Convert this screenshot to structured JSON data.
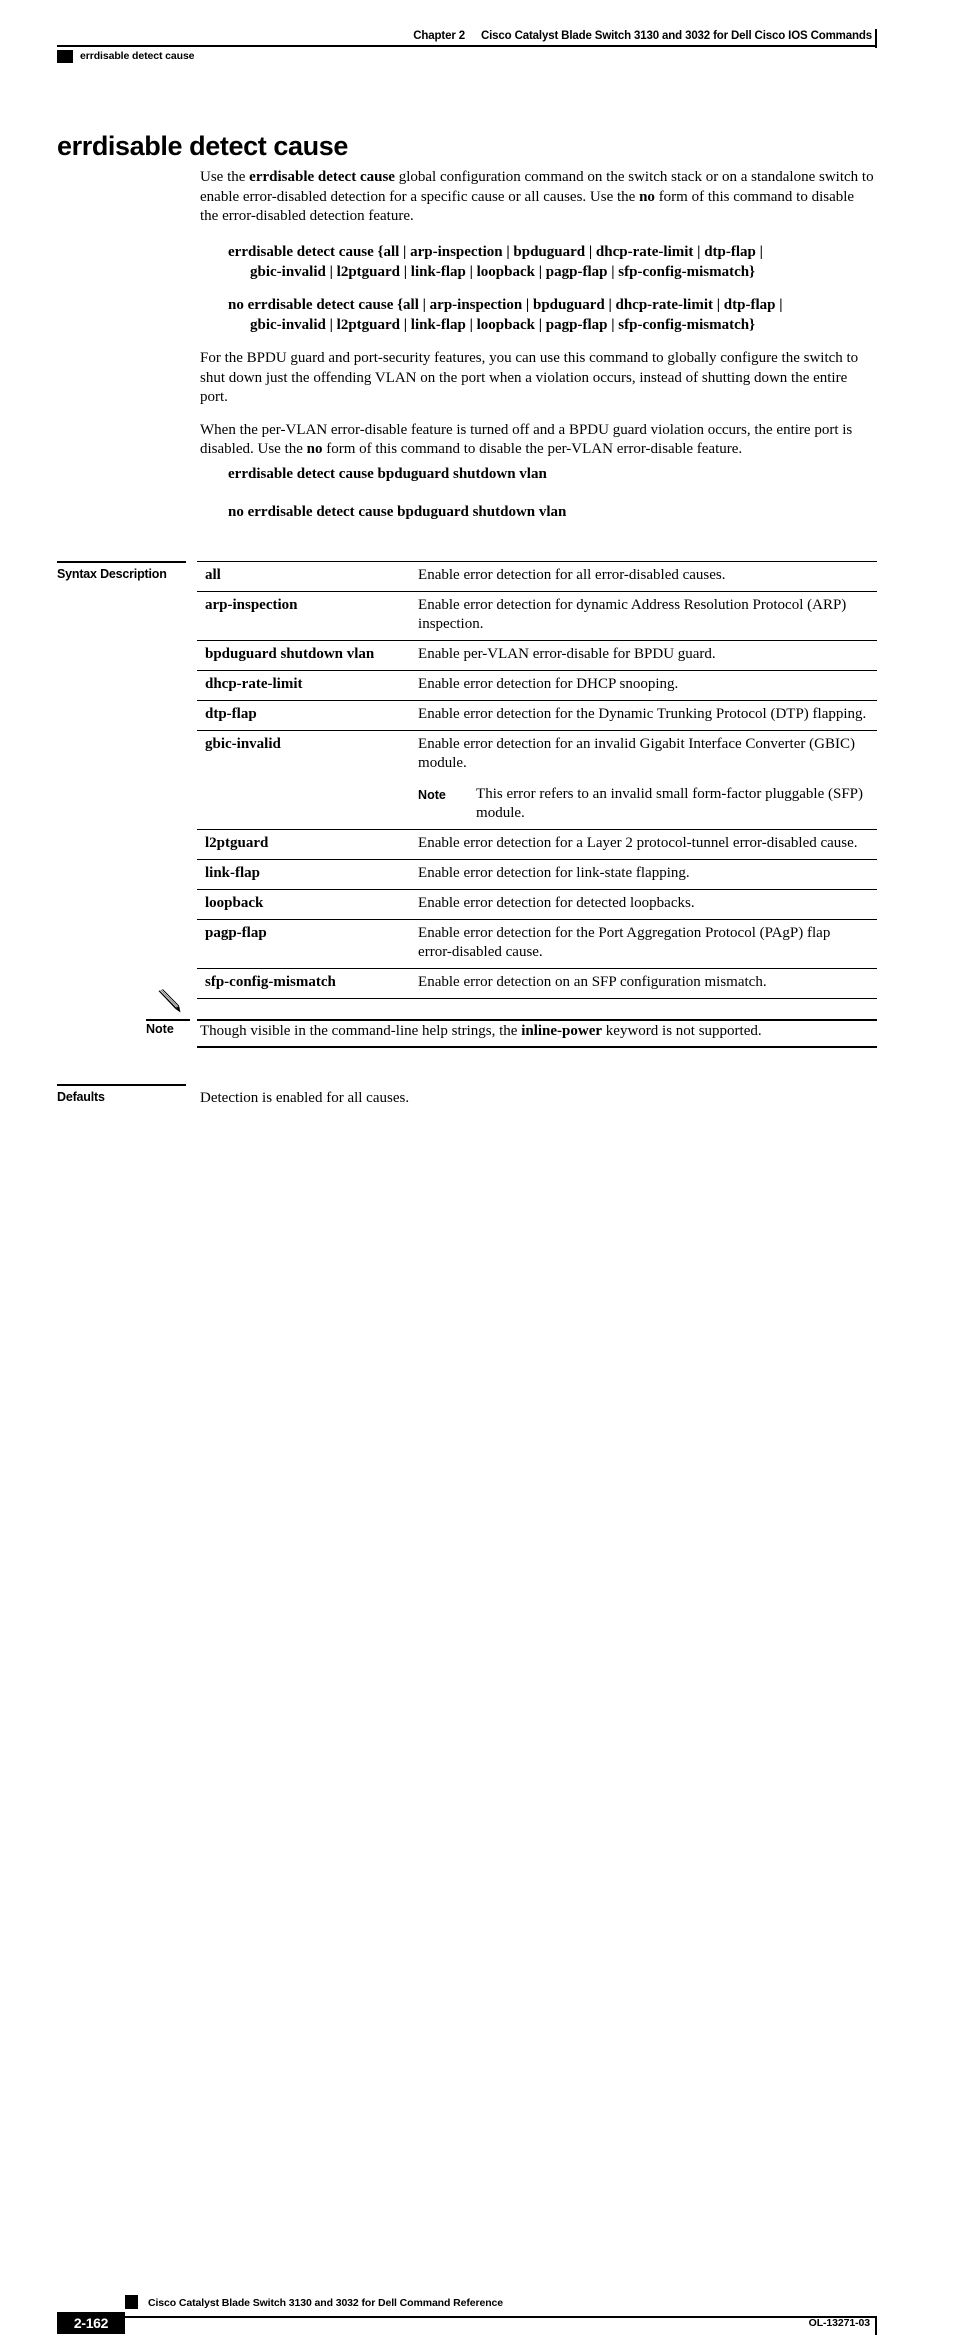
{
  "header": {
    "chapter": "Chapter 2",
    "book_title": "Cisco Catalyst Blade Switch 3130 and 3032 for Dell Cisco IOS Commands",
    "running_head": "errdisable detect cause"
  },
  "page_title": "errdisable detect cause",
  "intro": {
    "p1_a": "Use the ",
    "p1_b1": "errdisable detect cause",
    "p1_c": " global configuration command on the switch stack or on a standalone switch to enable error-disabled detection for a specific cause or all causes. Use the ",
    "p1_b2": "no",
    "p1_d": " form of this command to disable the error-disabled detection feature."
  },
  "syntax": {
    "line1_main": "errdisable detect cause {all | arp-inspection | bpduguard | dhcp-rate-limit | dtp-flap |",
    "line1_cont": "gbic-invalid | l2ptguard | link-flap | loopback | pagp-flap | sfp-config-mismatch}",
    "line2_main": "no errdisable detect cause {all | arp-inspection | bpduguard | dhcp-rate-limit | dtp-flap |",
    "line2_cont": "gbic-invalid | l2ptguard | link-flap | loopback | pagp-flap | sfp-config-mismatch}"
  },
  "body": {
    "p2": "For the BPDU guard and port-security features, you can use this command to globally configure the switch to shut down just the offending VLAN on the port when a violation occurs, instead of shutting down the entire port.",
    "p3_a": "When the per-VLAN error-disable feature is turned off and a BPDU guard violation occurs, the entire port is disabled. Use the ",
    "p3_b": "no",
    "p3_c": " form of this command to disable the per-VLAN error-disable feature.",
    "cmd1": "errdisable detect cause bpduguard shutdown vlan",
    "cmd2": "no errdisable detect cause bpduguard shutdown vlan"
  },
  "sections": {
    "syntax_description_label": "Syntax Description",
    "defaults_label": "Defaults",
    "defaults_text": "Detection is enabled for all causes."
  },
  "syntax_table": {
    "rows": [
      {
        "term": "all",
        "desc": "Enable error detection for all error-disabled causes."
      },
      {
        "term": "arp-inspection",
        "desc": "Enable error detection for dynamic Address Resolution Protocol (ARP) inspection."
      },
      {
        "term": "bpduguard shutdown vlan",
        "desc": "Enable per-VLAN error-disable for BPDU guard."
      },
      {
        "term": "dhcp-rate-limit",
        "desc": "Enable error detection for DHCP snooping."
      },
      {
        "term": "dtp-flap",
        "desc": "Enable error detection for the Dynamic Trunking Protocol (DTP) flapping."
      },
      {
        "term": "gbic-invalid",
        "desc": "Enable error detection for an invalid Gigabit Interface Converter (GBIC) module.",
        "note_label": "Note",
        "note_text": "This error refers to an invalid small form-factor pluggable (SFP) module."
      },
      {
        "term": "l2ptguard",
        "desc": "Enable error detection for a Layer 2 protocol-tunnel error-disabled cause."
      },
      {
        "term": "link-flap",
        "desc": "Enable error detection for link-state flapping."
      },
      {
        "term": "loopback",
        "desc": "Enable error detection for detected loopbacks."
      },
      {
        "term": "pagp-flap",
        "desc": "Enable error detection for the Port Aggregation Protocol (PAgP) flap error-disabled cause."
      },
      {
        "term": "sfp-config-mismatch",
        "desc": "Enable error detection on an SFP configuration mismatch."
      }
    ]
  },
  "note_callout": {
    "label": "Note",
    "text_a": "Though visible in the command-line help strings, the ",
    "text_b": "inline-power",
    "text_c": " keyword is not supported."
  },
  "footer": {
    "book_title": "Cisco Catalyst Blade Switch 3130 and 3032 for Dell Command Reference",
    "page_number": "2-162",
    "doc_id": "OL-13271-03"
  }
}
